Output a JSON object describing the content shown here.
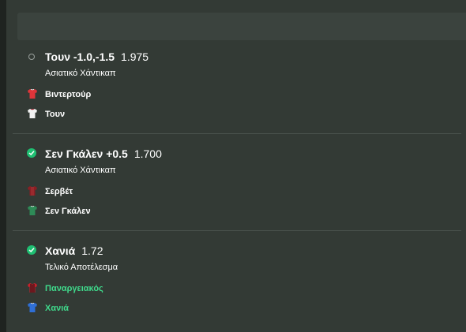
{
  "bets": [
    {
      "status": "pending",
      "selection": "Τουν -1.0,-1.5",
      "odds": "1.975",
      "market": "Ασιατικό Χάντικαπ",
      "home": {
        "name": "Βιντερτούρ",
        "kit_icon": "red-shirt-icon",
        "highlight": false
      },
      "away": {
        "name": "Τουν",
        "kit_icon": "white-shirt-icon",
        "highlight": false
      }
    },
    {
      "status": "won",
      "selection": "Σεν Γκάλεν +0.5",
      "odds": "1.700",
      "market": "Ασιατικό Χάντικαπ",
      "home": {
        "name": "Σερβέτ",
        "kit_icon": "maroon-shirt-icon",
        "highlight": false
      },
      "away": {
        "name": "Σεν Γκάλεν",
        "kit_icon": "green-shirt-icon",
        "highlight": false
      }
    },
    {
      "status": "won",
      "selection": "Χανιά",
      "odds": "1.72",
      "market": "Τελικό Αποτέλεσμα",
      "home": {
        "name": "Παναργειακός",
        "kit_icon": "red-black-striped-shirt-icon",
        "highlight": true
      },
      "away": {
        "name": "Χανιά",
        "kit_icon": "blue-shirt-icon",
        "highlight": true
      }
    }
  ],
  "colors": {
    "accent_green": "#1fbf72",
    "highlight_text": "#3fd98b",
    "panel": "#333a35"
  }
}
